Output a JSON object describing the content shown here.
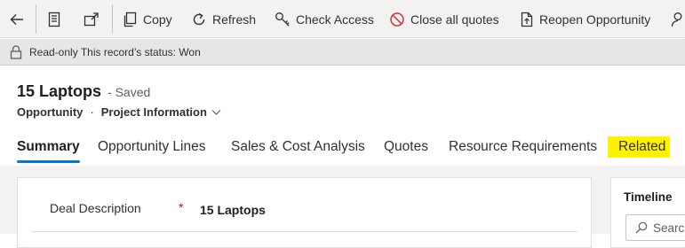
{
  "toolbar": {
    "copy_label": "Copy",
    "refresh_label": "Refresh",
    "check_access_label": "Check Access",
    "close_quotes_label": "Close all quotes",
    "reopen_label": "Reopen Opportunity"
  },
  "notification": {
    "text": "Read-only This record’s status: Won"
  },
  "header": {
    "title": "15 Laptops",
    "save_state": "- Saved",
    "entity": "Opportunity",
    "separator": "·",
    "form_name": "Project Information"
  },
  "tabs": [
    {
      "label": "Summary",
      "active": true
    },
    {
      "label": "Opportunity Lines",
      "active": false
    },
    {
      "label": "Sales & Cost Analysis",
      "active": false
    },
    {
      "label": "Quotes",
      "active": false
    },
    {
      "label": "Resource Requirements",
      "active": false
    },
    {
      "label": "Related",
      "active": false
    }
  ],
  "form": {
    "field_label": "Deal Description",
    "required_marker": "*",
    "field_value": "15 Laptops"
  },
  "timeline": {
    "title": "Timeline",
    "search_placeholder": "Searc"
  },
  "colors": {
    "accent": "#0078d4",
    "highlight": "#fff200",
    "required": "#a4262c"
  }
}
